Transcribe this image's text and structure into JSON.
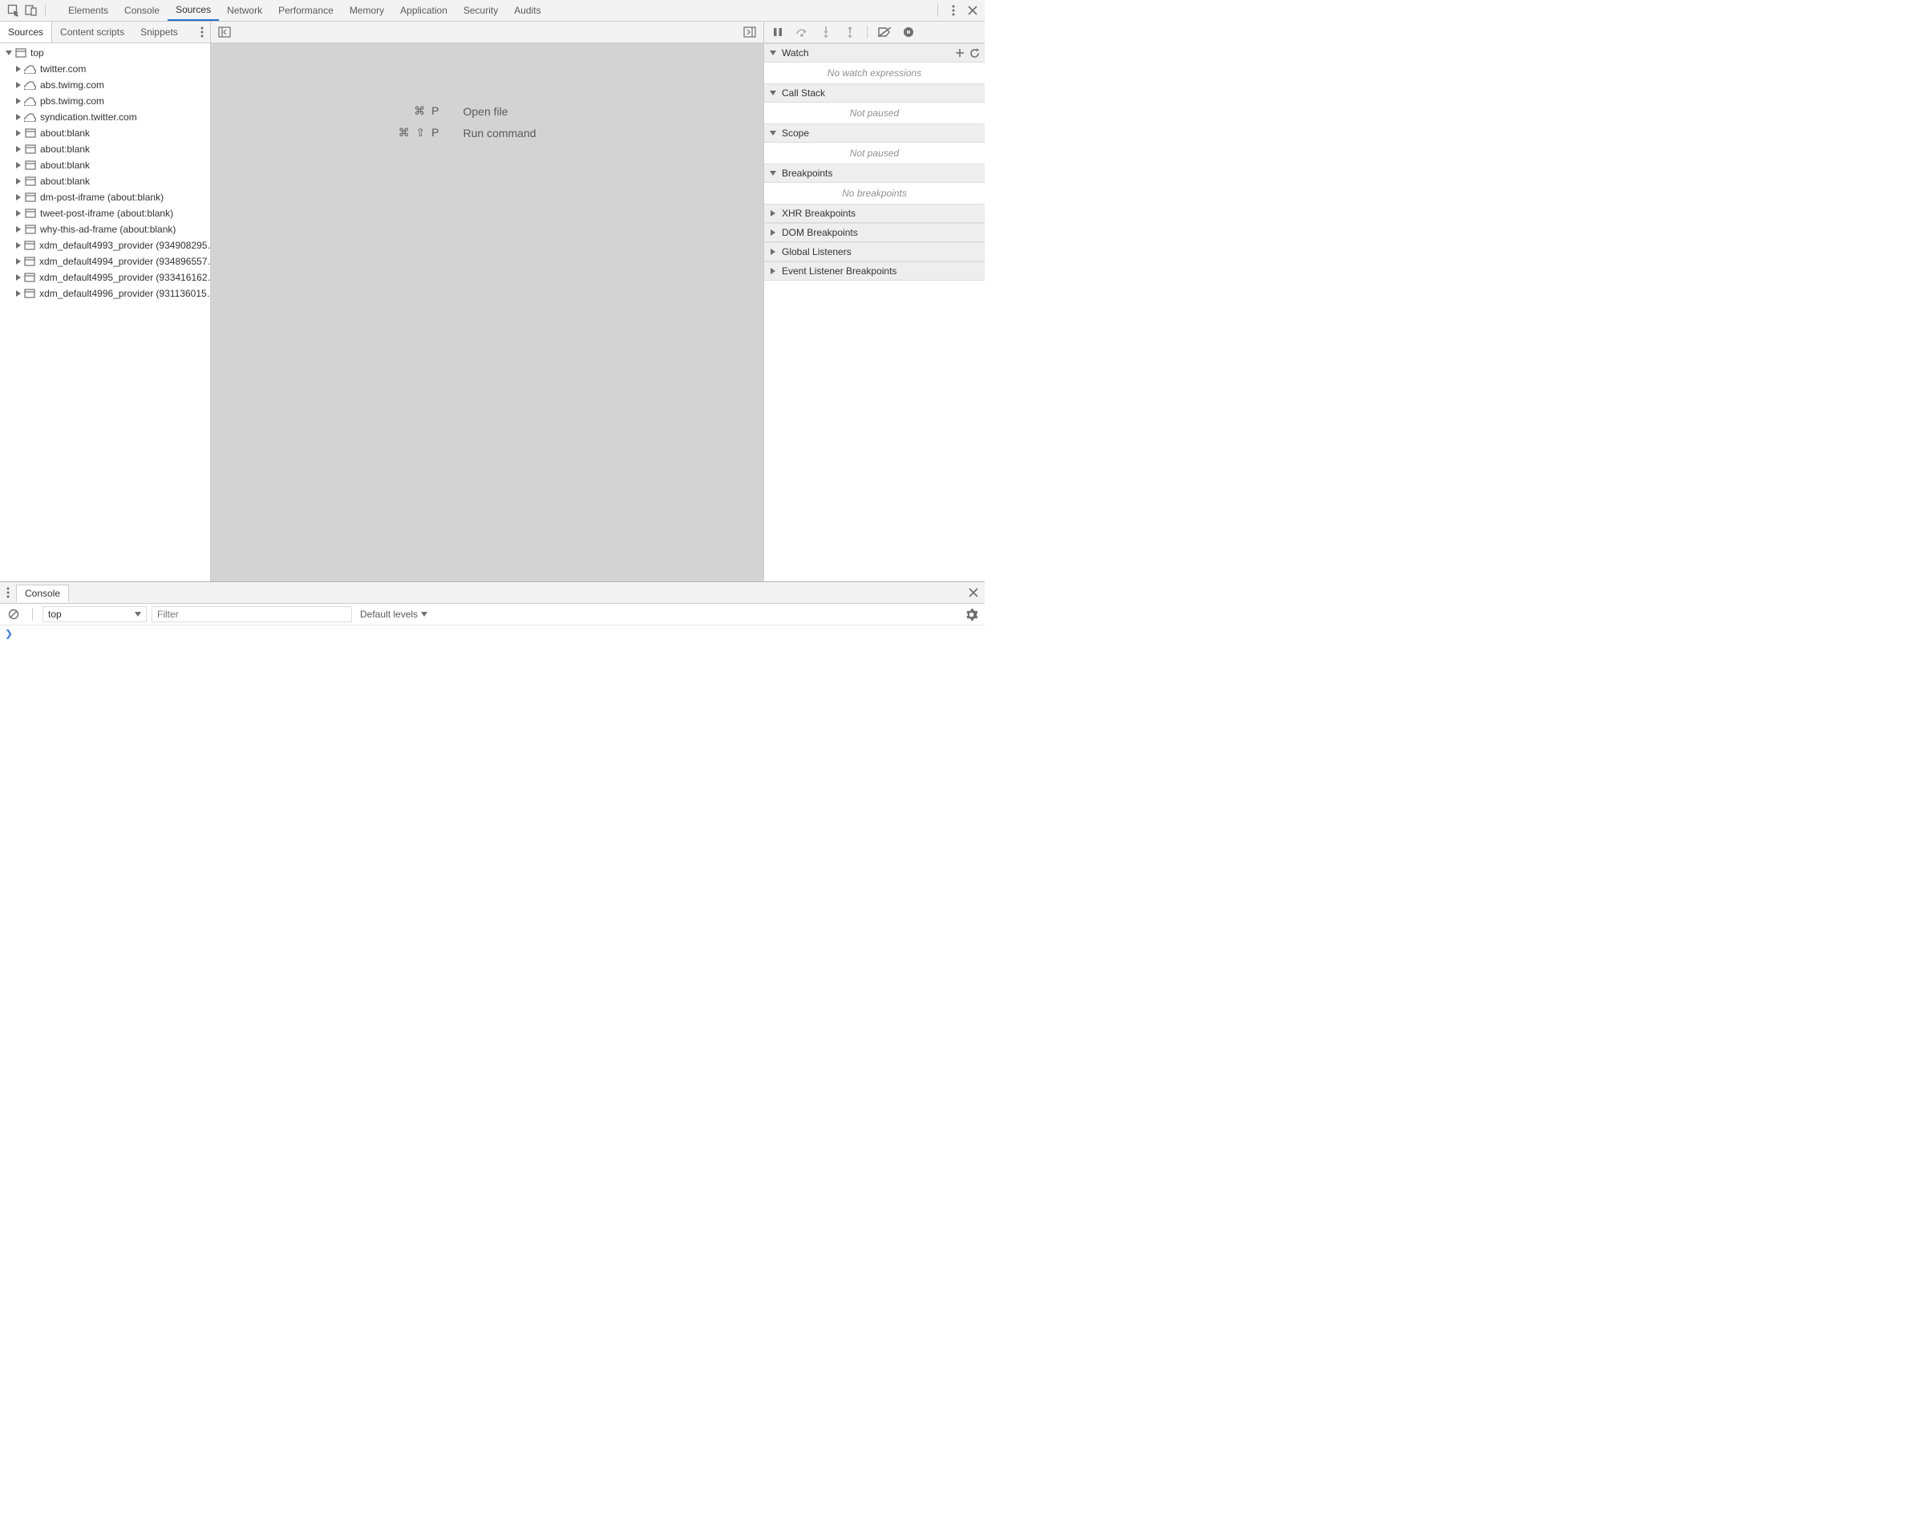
{
  "topTabs": [
    "Elements",
    "Console",
    "Sources",
    "Network",
    "Performance",
    "Memory",
    "Application",
    "Security",
    "Audits"
  ],
  "topActive": "Sources",
  "navTabs": [
    "Sources",
    "Content scripts",
    "Snippets"
  ],
  "navActive": "Sources",
  "tree": {
    "root": "top",
    "items": [
      {
        "icon": "cloud",
        "label": "twitter.com"
      },
      {
        "icon": "cloud",
        "label": "abs.twimg.com"
      },
      {
        "icon": "cloud",
        "label": "pbs.twimg.com"
      },
      {
        "icon": "cloud",
        "label": "syndication.twitter.com"
      },
      {
        "icon": "frame",
        "label": "about:blank"
      },
      {
        "icon": "frame",
        "label": "about:blank"
      },
      {
        "icon": "frame",
        "label": "about:blank"
      },
      {
        "icon": "frame",
        "label": "about:blank"
      },
      {
        "icon": "frame",
        "label": "dm-post-iframe (about:blank)"
      },
      {
        "icon": "frame",
        "label": "tweet-post-iframe (about:blank)"
      },
      {
        "icon": "frame",
        "label": "why-this-ad-frame (about:blank)"
      },
      {
        "icon": "frame",
        "label": "xdm_default4993_provider (934908295…"
      },
      {
        "icon": "frame",
        "label": "xdm_default4994_provider (934896557…"
      },
      {
        "icon": "frame",
        "label": "xdm_default4995_provider (933416162…"
      },
      {
        "icon": "frame",
        "label": "xdm_default4996_provider (931136015…"
      }
    ]
  },
  "shortcuts": {
    "openFile": {
      "keys": "⌘ P",
      "label": "Open file"
    },
    "runCmd": {
      "keys": "⌘ ⇧ P",
      "label": "Run command"
    }
  },
  "debugger": {
    "sections": {
      "watch": {
        "title": "Watch",
        "body": "No watch expressions",
        "open": true,
        "buttons": true
      },
      "callstack": {
        "title": "Call Stack",
        "body": "Not paused",
        "open": true
      },
      "scope": {
        "title": "Scope",
        "body": "Not paused",
        "open": true
      },
      "breakpoints": {
        "title": "Breakpoints",
        "body": "No breakpoints",
        "open": true
      },
      "xhr": {
        "title": "XHR Breakpoints",
        "open": false
      },
      "dom": {
        "title": "DOM Breakpoints",
        "open": false
      },
      "global": {
        "title": "Global Listeners",
        "open": false
      },
      "event": {
        "title": "Event Listener Breakpoints",
        "open": false
      }
    }
  },
  "drawer": {
    "tab": "Console",
    "context": "top",
    "filterPlaceholder": "Filter",
    "levels": "Default levels"
  }
}
